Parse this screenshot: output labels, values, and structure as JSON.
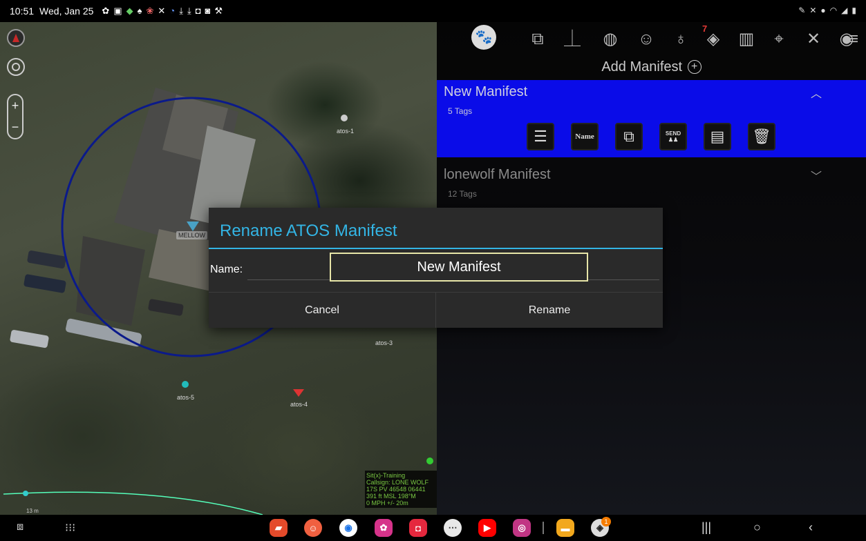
{
  "status_bar": {
    "time": "10:51",
    "date": "Wed, Jan 25"
  },
  "map": {
    "markers": [
      "atos-1",
      "MELLOW",
      "atos-3",
      "atos-5",
      "atos-4"
    ],
    "info_box": [
      "Sit(x)-Training",
      "Callsign: LONE WOLF",
      "17S PV 46548 06441",
      "391 ft MSL      198°M",
      "0 MPH          +/- 20m"
    ],
    "scale_label": "13 m",
    "colors": {
      "range_circle": "#0b1a8a",
      "info_text": "#7ac943"
    }
  },
  "toolbar": {
    "icons": [
      "paw-icon",
      "export-icon",
      "measure-icon",
      "globe-icon",
      "contacts-icon",
      "layers-icon",
      "map-icon",
      "add-point-icon",
      "tools-icon",
      "emergency-icon",
      "menu-icon"
    ],
    "contacts_badge": "7"
  },
  "panel": {
    "add_manifest_label": "Add Manifest",
    "manifests": [
      {
        "title": "New Manifest",
        "tags": "5 Tags",
        "expanded": true
      },
      {
        "title": "lonewolf Manifest",
        "tags": "12 Tags",
        "expanded": false
      }
    ],
    "actions": {
      "name_label": "Name",
      "send_label": "SEND"
    },
    "colors": {
      "selected_bg": "#0a0ce8"
    }
  },
  "dialog": {
    "title": "Rename ATOS Manifest",
    "name_label": "Name:",
    "name_value": "New Manifest",
    "cancel_label": "Cancel",
    "rename_label": "Rename",
    "colors": {
      "title": "#33b5e5",
      "input_border": "#e8e6a8"
    }
  },
  "nav": {
    "dock_apps": [
      "flipboard",
      "contacts",
      "chrome",
      "bixby",
      "camera",
      "messages",
      "youtube",
      "instagram",
      "files",
      "atak"
    ],
    "dock_badge": "1"
  }
}
